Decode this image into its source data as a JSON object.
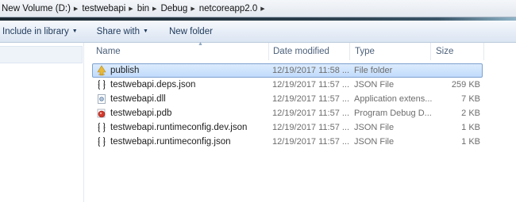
{
  "address_bar": {
    "crumbs": [
      "New Volume (D:)",
      "testwebapi",
      "bin",
      "Debug",
      "netcoreapp2.0"
    ]
  },
  "toolbar": {
    "include_in_library": "Include in library",
    "share_with": "Share with",
    "new_folder": "New folder"
  },
  "columns": {
    "name": "Name",
    "date_modified": "Date modified",
    "type": "Type",
    "size": "Size"
  },
  "files": [
    {
      "name": "publish",
      "date": "12/19/2017 11:58 ...",
      "type": "File folder",
      "size": "",
      "icon": "folder-icon",
      "selected": true
    },
    {
      "name": "testwebapi.deps.json",
      "date": "12/19/2017 11:57 ...",
      "type": "JSON File",
      "size": "259 KB",
      "icon": "json-file-icon",
      "selected": false
    },
    {
      "name": "testwebapi.dll",
      "date": "12/19/2017 11:57 ...",
      "type": "Application extens...",
      "size": "7 KB",
      "icon": "dll-file-icon",
      "selected": false
    },
    {
      "name": "testwebapi.pdb",
      "date": "12/19/2017 11:57 ...",
      "type": "Program Debug D...",
      "size": "2 KB",
      "icon": "pdb-file-icon",
      "selected": false
    },
    {
      "name": "testwebapi.runtimeconfig.dev.json",
      "date": "12/19/2017 11:57 ...",
      "type": "JSON File",
      "size": "1 KB",
      "icon": "json-file-icon",
      "selected": false
    },
    {
      "name": "testwebapi.runtimeconfig.json",
      "date": "12/19/2017 11:57 ...",
      "type": "JSON File",
      "size": "1 KB",
      "icon": "json-file-icon",
      "selected": false
    }
  ],
  "colors": {
    "selection_fill": "#cce1fb",
    "selection_border": "#7da2ce",
    "toolbar_text": "#1e395b",
    "header_text": "#4c607a",
    "detail_text": "#6d6d6d"
  }
}
